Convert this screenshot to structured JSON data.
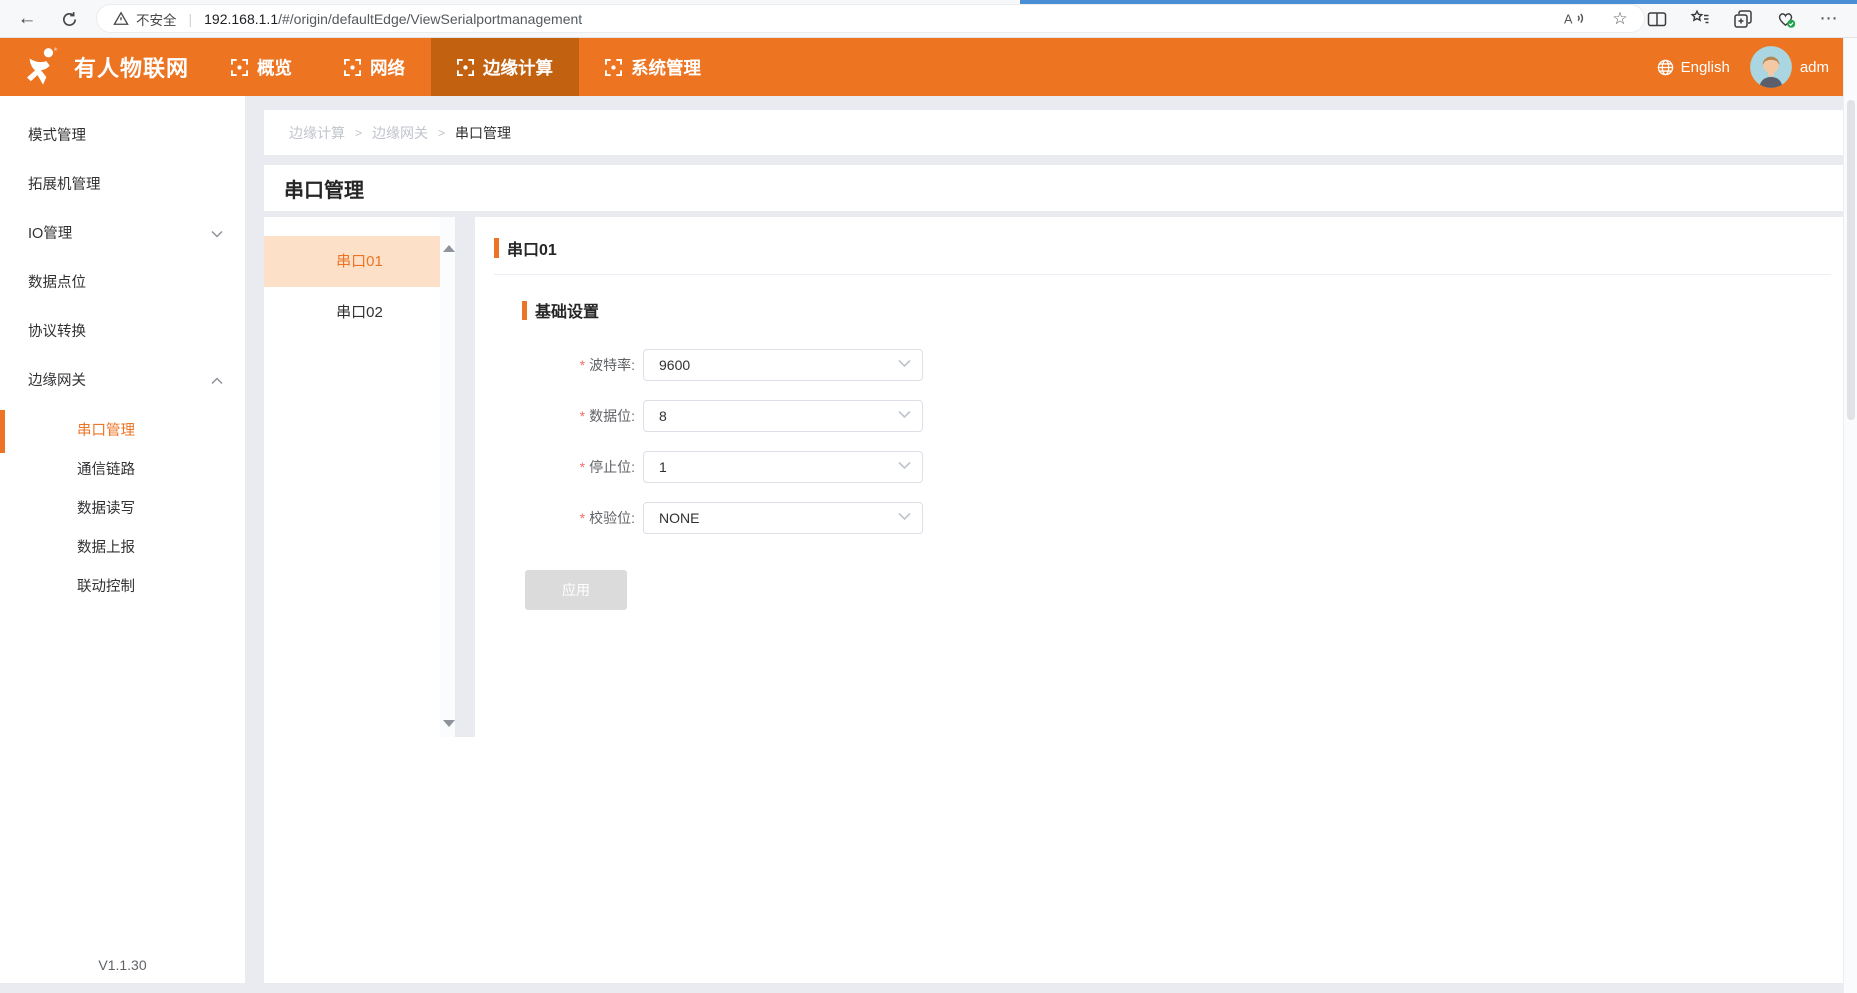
{
  "browser": {
    "address": {
      "security_warning": "不安全",
      "url_domain": "192.168.1.1",
      "url_path": "/#/origin/defaultEdge/ViewSerialportmanagement"
    },
    "toolbar_icons": [
      "back",
      "refresh",
      "read-aloud",
      "favorite-star",
      "split-screen",
      "favorites-bar",
      "collections",
      "browser-essentials",
      "more"
    ]
  },
  "header": {
    "brand": "有人物联网",
    "tabs": [
      {
        "label": "概览",
        "active": false
      },
      {
        "label": "网络",
        "active": false
      },
      {
        "label": "边缘计算",
        "active": true
      },
      {
        "label": "系统管理",
        "active": false
      }
    ],
    "language": "English",
    "username": "adm"
  },
  "sidebar": {
    "items": [
      {
        "label": "模式管理"
      },
      {
        "label": "拓展机管理"
      },
      {
        "label": "IO管理",
        "expanded": false
      },
      {
        "label": "数据点位"
      },
      {
        "label": "协议转换"
      },
      {
        "label": "边缘网关",
        "expanded": true
      }
    ],
    "subitems": [
      {
        "label": "串口管理",
        "active": true
      },
      {
        "label": "通信链路",
        "active": false
      },
      {
        "label": "数据读写",
        "active": false
      },
      {
        "label": "数据上报",
        "active": false
      },
      {
        "label": "联动控制",
        "active": false
      }
    ],
    "version": "V1.1.30"
  },
  "breadcrumb": {
    "items": [
      "边缘计算",
      "边缘网关",
      "串口管理"
    ],
    "separator": ">"
  },
  "page": {
    "title": "串口管理"
  },
  "port_list": {
    "items": [
      {
        "label": "串口01",
        "active": true
      },
      {
        "label": "串口02",
        "active": false
      }
    ]
  },
  "panel": {
    "heading": "串口01",
    "section": "基础设置",
    "required_mark": "*",
    "fields": [
      {
        "label": "波特率:",
        "value": "9600"
      },
      {
        "label": "数据位:",
        "value": "8"
      },
      {
        "label": "停止位:",
        "value": "1"
      },
      {
        "label": "校验位:",
        "value": "NONE"
      }
    ],
    "apply_label": "应用",
    "apply_disabled": true
  },
  "colors": {
    "header_orange": "#ed7421",
    "header_active_tab": "#c2610f",
    "accent_orange": "#ed7425",
    "list_active_bg": "#fce1c8",
    "page_background": "#e9ebf1",
    "disabled_button": "#dbdbdb",
    "required_red": "#f56c6c",
    "top_accent_strip": "#4a8ed6"
  }
}
